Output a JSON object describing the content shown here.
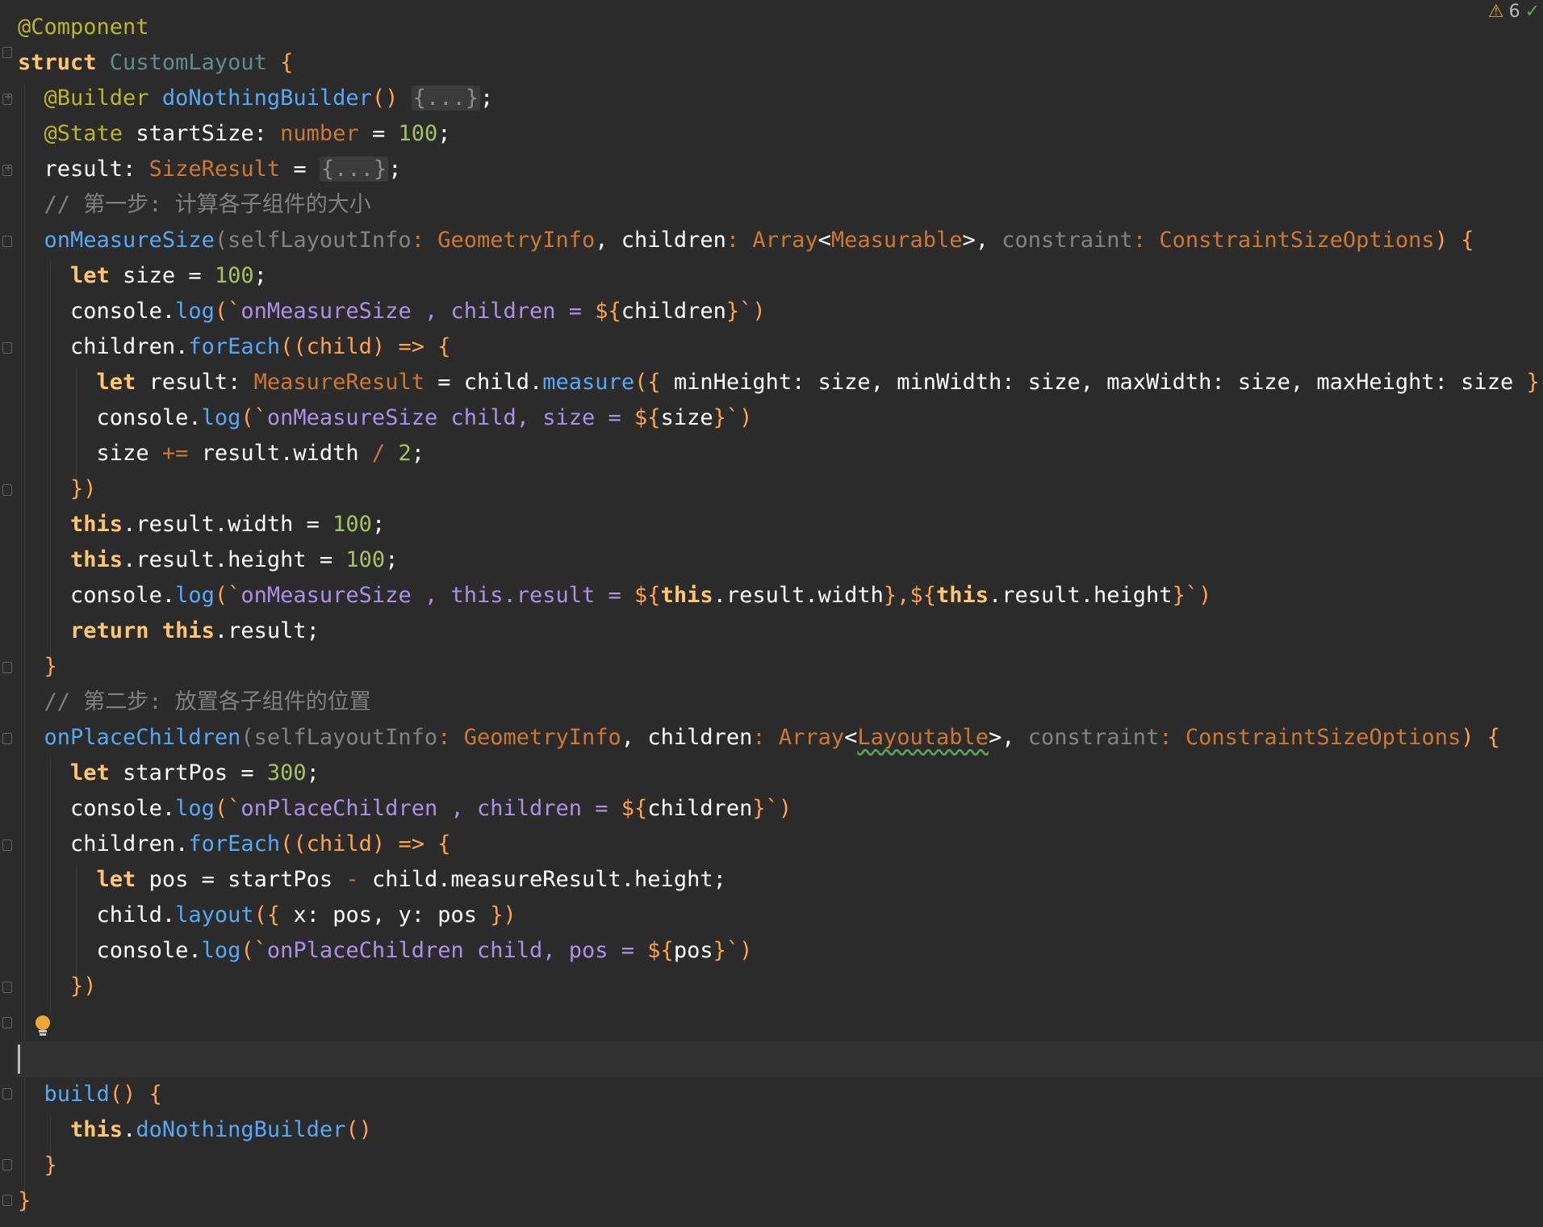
{
  "status": {
    "warning_count": "6",
    "warning_icon": "warning-triangle-icon",
    "check_icon": "inspection-ok-icon"
  },
  "tokens": {
    "comp_ann": "@Component",
    "l1_struct": "struct",
    "l1_name": " CustomLayout ",
    "brace_open": "{",
    "brace_close": "}",
    "l2_ann": "@Builder",
    "l2_fn": "doNothingBuilder",
    "l2_paren": "()",
    "l2_fold": "{...}",
    "semi": ";",
    "l3_ann": "@State",
    "l3_var": " startSize: ",
    "l3_type": "number",
    "l3_eq": " = ",
    "l3_num": "100",
    "l4_var": "result: ",
    "l4_type": "SizeResult",
    "l4_eq": " = ",
    "l4_fold": "{...}",
    "c1": "// 第一步: 计算各子组件的大小",
    "m1_fn": "onMeasureSize",
    "m1_p1": "(selfLayoutInfo",
    "m1_colon": ": ",
    "m1_t1": "GeometryInfo",
    "m1_c1": ", ",
    "m1_p2": "children",
    "m1_t2": "Array",
    "m1_lt": "<",
    "m1_t3": "Measurable",
    "m1_gt": ">",
    "m1_p3": "constraint",
    "m1_t4": "ConstraintSizeOptions",
    "m1_close": ") ",
    "a1_let": "let",
    "a1_rest": " size = ",
    "a1_num": "100",
    "a2_console": "console.",
    "a2_log": "log",
    "a2_open": "(`",
    "a2_s1": "onMeasureSize , children = ",
    "a2_dollar": "${",
    "a2_var": "children",
    "a2_end": "}`)",
    "a3_obj": "children.",
    "a3_fn": "forEach",
    "a3_args": "((child) => ",
    "b1_let": "let",
    "b1_var": " result: ",
    "b1_type": "MeasureResult",
    "b1_eq": " = child.",
    "b1_fn": "measure",
    "b1_open": "({ ",
    "b1_args": "minHeight: size, minWidth: size, maxWidth: size, maxHeight: size ",
    "b1_close": "})",
    "b2_console": "console.",
    "b2_log": "log",
    "b2_open": "(`",
    "b2_s1": "onMeasureSize child, size = ",
    "b2_dollar": "${",
    "b2_var": "size",
    "b2_end": "}`)",
    "b3_a": "size ",
    "b3_op": "+=",
    "b3_b": " result.width ",
    "b3_div": "/",
    "b3_sp": " ",
    "b3_num": "2",
    "close_paren_brace": "})",
    "d1_this": "this",
    "d1_rest": ".result.width = ",
    "d1_num": "100",
    "d2_this": "this",
    "d2_rest": ".result.height = ",
    "d2_num": "100",
    "d3_console": "console.",
    "d3_log": "log",
    "d3_open": "(`",
    "d3_s1": "onMeasureSize , this.result = ",
    "d3_d1": "${",
    "d3_this1": "this",
    "d3_v1": ".result.width",
    "d3_mid": "},${",
    "d3_this2": "this",
    "d3_v2": ".result.height",
    "d3_end": "}`)",
    "d4_ret": "return",
    "d4_sp": " ",
    "d4_this": "this",
    "d4_rest": ".result;",
    "c2": "// 第二步: 放置各子组件的位置",
    "p1_fn": "onPlaceChildren",
    "p1_t3": "Layoutable",
    "e1_let": "let",
    "e1_rest": " startPos = ",
    "e1_num": "300",
    "e2_s1": "onPlaceChildren , children = ",
    "f1_let": "let",
    "f1_rest": " pos = startPos ",
    "f1_minus": "-",
    "f1_rest2": " child.measureResult.height;",
    "f2_obj": "child.",
    "f2_fn": "layout",
    "f2_open": "({ ",
    "f2_args": "x: pos, y: pos ",
    "f2_close": "})",
    "f3_s1": "onPlaceChildren child, pos = ",
    "f3_var": "pos",
    "g1_fn": "build",
    "g1_paren": "() ",
    "g2_this": "this",
    "g2_dot": ".",
    "g2_fn": "doNothingBuilder",
    "g2_paren": "()"
  },
  "icons": {
    "bulb": "lightbulb-icon",
    "fold": "fold-marker-icon"
  }
}
